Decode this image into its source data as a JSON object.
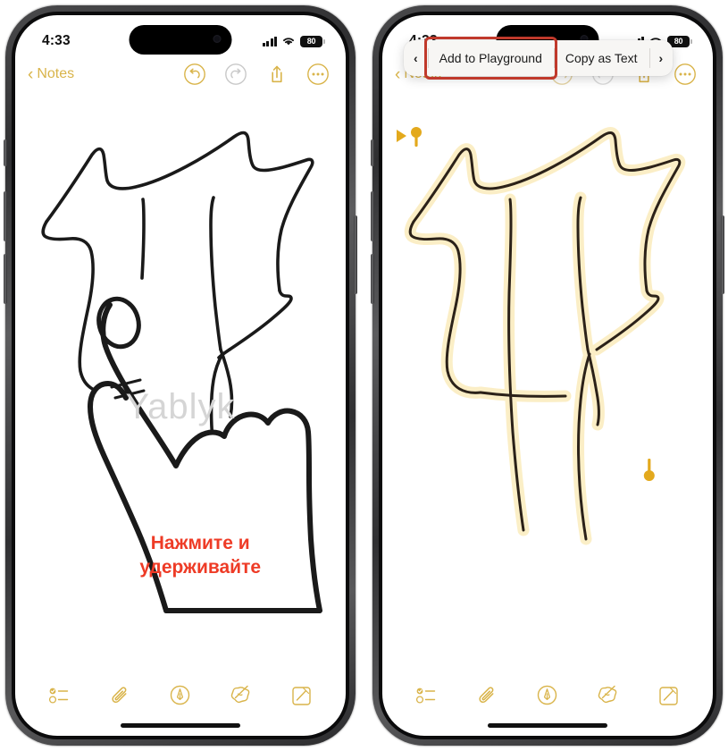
{
  "page": {
    "watermark": "Yablyk",
    "background_color": "#ffffff"
  },
  "colors": {
    "accent_yellow": "#d9b44a",
    "highlight_red": "#c0392b",
    "hint_red": "#ee3b26",
    "selection_glow": "#fbeec4",
    "ink_black": "#1a1a1a",
    "disabled_gray": "#bdbdbd"
  },
  "phones": [
    {
      "id": "left-phone",
      "status_bar": {
        "time": "4:33",
        "battery_level": "80",
        "signal_icon": "cellular-bars-icon",
        "wifi_icon": "wifi-icon",
        "battery_icon": "battery-icon"
      },
      "nav_bar": {
        "back_label": "Notes",
        "back_icon": "chevron-left-icon",
        "actions": [
          {
            "name": "undo-button",
            "icon": "undo-icon",
            "enabled": true
          },
          {
            "name": "redo-button",
            "icon": "redo-icon",
            "enabled": false
          },
          {
            "name": "share-button",
            "icon": "share-icon",
            "enabled": true
          },
          {
            "name": "more-button",
            "icon": "ellipsis-circle-icon",
            "enabled": true
          }
        ]
      },
      "content": {
        "hint_line_1": "Нажмите и",
        "hint_line_2": "удерживайте",
        "drawing": "handwritten-sketch",
        "pointer": "hand-pointing-illustration"
      },
      "toolbar": [
        {
          "name": "checklist-button",
          "icon": "checklist-icon"
        },
        {
          "name": "attachment-button",
          "icon": "paperclip-icon"
        },
        {
          "name": "markup-button",
          "icon": "markup-pen-circle-icon"
        },
        {
          "name": "scribble-button",
          "icon": "scribble-sparkle-icon"
        },
        {
          "name": "compose-button",
          "icon": "compose-square-icon"
        }
      ]
    },
    {
      "id": "right-phone",
      "status_bar": {
        "time": "4:33",
        "battery_level": "80",
        "signal_icon": "cellular-bars-icon",
        "wifi_icon": "wifi-icon",
        "battery_icon": "battery-icon"
      },
      "nav_bar": {
        "back_label": "Notes",
        "back_icon": "chevron-left-icon",
        "actions": [
          {
            "name": "undo-button",
            "icon": "undo-icon",
            "enabled": true
          },
          {
            "name": "redo-button",
            "icon": "redo-icon",
            "enabled": false
          },
          {
            "name": "share-button",
            "icon": "share-icon",
            "enabled": true
          },
          {
            "name": "more-button",
            "icon": "ellipsis-circle-icon",
            "enabled": true
          }
        ]
      },
      "context_menu": {
        "prev_label": "‹",
        "next_label": "›",
        "items": [
          {
            "label": "Add to Playground",
            "highlighted": true
          },
          {
            "label": "Copy as Text",
            "highlighted": false
          }
        ]
      },
      "content": {
        "drawing": "handwritten-sketch-selected",
        "selection_start_handle": "selection-handle-start",
        "selection_end_handle": "selection-handle-end"
      },
      "toolbar": [
        {
          "name": "checklist-button",
          "icon": "checklist-icon"
        },
        {
          "name": "attachment-button",
          "icon": "paperclip-icon"
        },
        {
          "name": "markup-button",
          "icon": "markup-pen-circle-icon"
        },
        {
          "name": "scribble-button",
          "icon": "scribble-sparkle-icon"
        },
        {
          "name": "compose-button",
          "icon": "compose-square-icon"
        }
      ]
    }
  ]
}
